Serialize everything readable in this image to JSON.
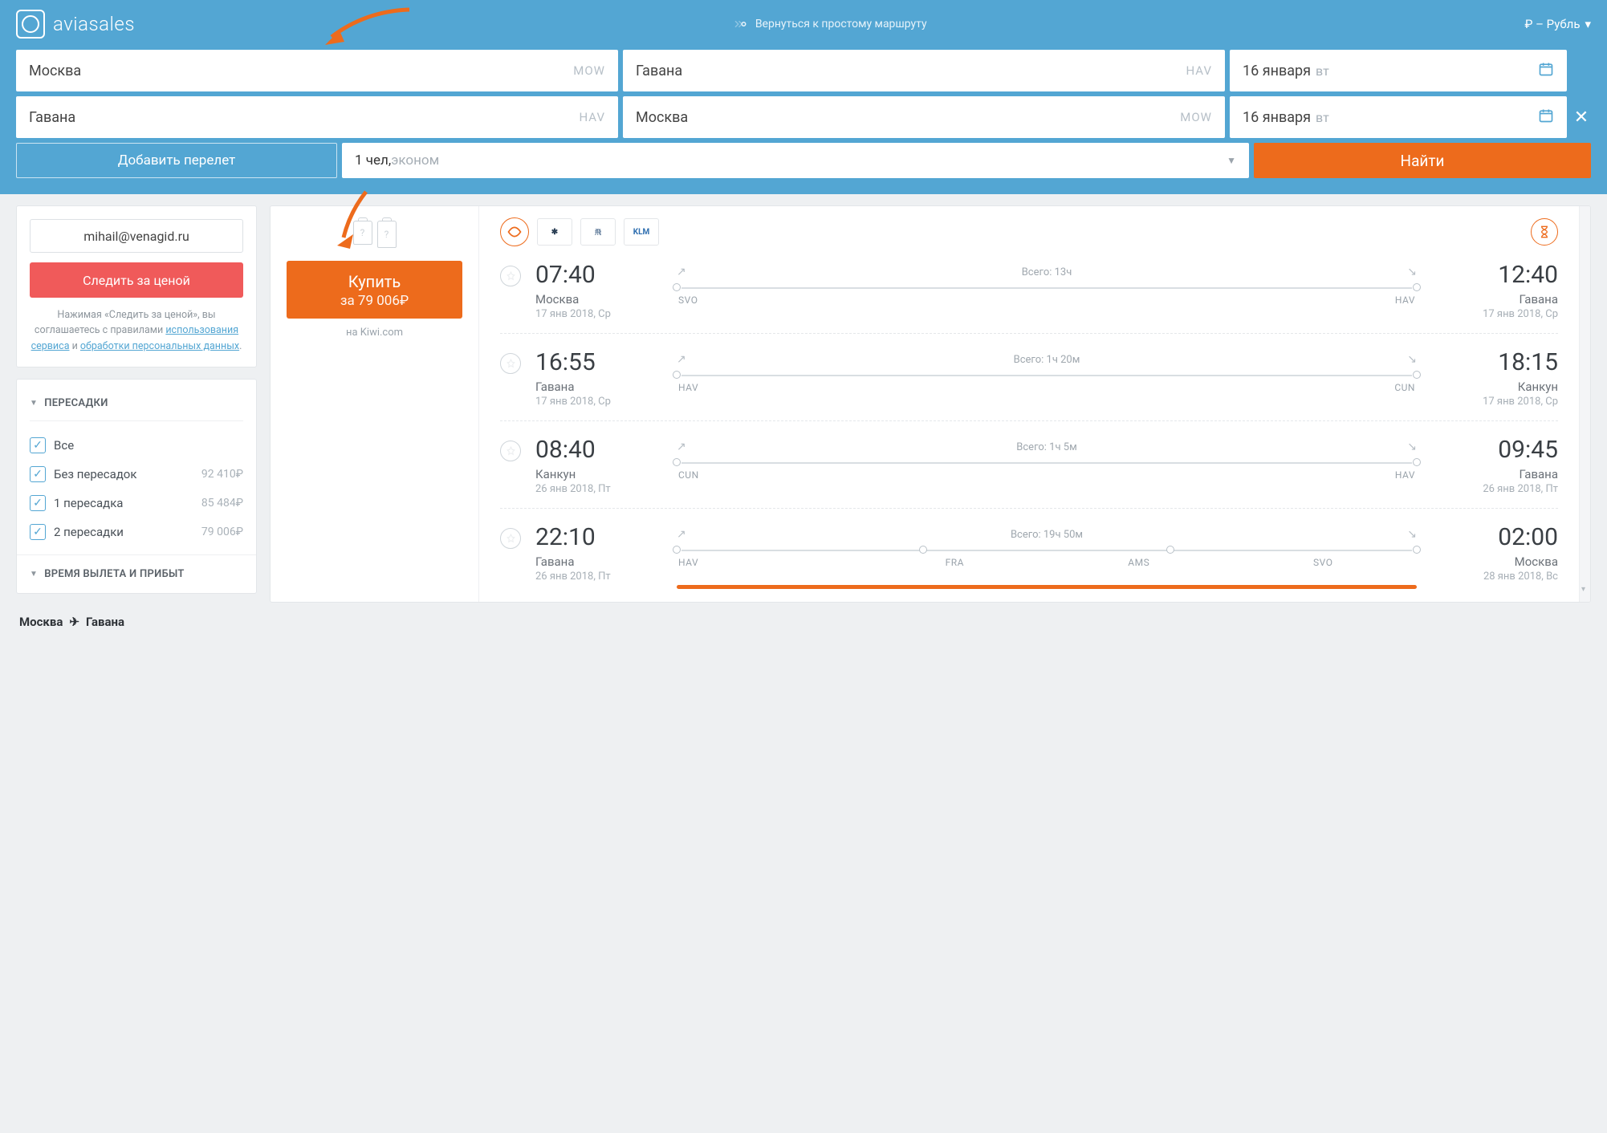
{
  "header": {
    "brand": "aviasales",
    "simple_route": "Вернуться к простому маршруту",
    "currency": "₽ – Рубль"
  },
  "search": {
    "rows": [
      {
        "from": "Москва",
        "from_code": "MOW",
        "to": "Гавана",
        "to_code": "HAV",
        "date": "16 января",
        "dow": "вт"
      },
      {
        "from": "Гавана",
        "from_code": "HAV",
        "to": "Москва",
        "to_code": "MOW",
        "date": "16 января",
        "dow": "вт"
      }
    ],
    "add_flight": "Добавить перелет",
    "pax_main": "1 чел,",
    "pax_class": " эконом",
    "search_btn": "Найти"
  },
  "sidebar": {
    "email": "mihail@venagid.ru",
    "watch": "Следить за ценой",
    "legal_pre": "Нажимая «Следить за ценой», вы соглашаетесь с правилами ",
    "legal_link1": "использования сервиса",
    "legal_mid": " и ",
    "legal_link2": "обработки персональных данных",
    "legal_post": ".",
    "filters": {
      "stops_title": "ПЕРЕСАДКИ",
      "options": [
        {
          "label": "Все",
          "price": ""
        },
        {
          "label": "Без пересадок",
          "price": "92 410₽"
        },
        {
          "label": "1 пересадка",
          "price": "85 484₽"
        },
        {
          "label": "2 пересадки",
          "price": "79 006₽"
        }
      ],
      "time_title": "ВРЕМЯ ВЫЛЕТА И ПРИБЫТ"
    },
    "route": {
      "from": "Москва",
      "to": "Гавана"
    }
  },
  "ticket": {
    "buy_l1": "Купить",
    "buy_l2": "за 79 006₽",
    "vendor": "на Kiwi.com",
    "airlines": [
      "Condor",
      "Interjet",
      "Аэрофлот",
      "KLM"
    ],
    "duration_prefix": "Всего: ",
    "segments": [
      {
        "dep_time": "07:40",
        "dep_city": "Москва",
        "dep_date": "17 янв 2018, Ср",
        "arr_time": "12:40",
        "arr_city": "Гавана",
        "arr_date": "17 янв 2018, Ср",
        "dur": "13ч",
        "codes": [
          "SVO",
          "HAV"
        ]
      },
      {
        "dep_time": "16:55",
        "dep_city": "Гавана",
        "dep_date": "17 янв 2018, Ср",
        "arr_time": "18:15",
        "arr_city": "Канкун",
        "arr_date": "17 янв 2018, Ср",
        "dur": "1ч 20м",
        "codes": [
          "HAV",
          "CUN"
        ]
      },
      {
        "dep_time": "08:40",
        "dep_city": "Канкун",
        "dep_date": "26 янв 2018, Пт",
        "arr_time": "09:45",
        "arr_city": "Гавана",
        "arr_date": "26 янв 2018, Пт",
        "dur": "1ч 5м",
        "codes": [
          "CUN",
          "HAV"
        ]
      },
      {
        "dep_time": "22:10",
        "dep_city": "Гавана",
        "dep_date": "26 янв 2018, Пт",
        "arr_time": "02:00",
        "arr_city": "Москва",
        "arr_date": "28 янв 2018, Вс",
        "dur": "19ч 50м",
        "codes": [
          "HAV",
          "FRA",
          "AMS",
          "SVO"
        ],
        "highlight": true
      }
    ]
  }
}
